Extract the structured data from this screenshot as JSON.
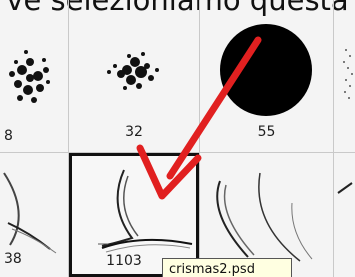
{
  "caption_text": "ve selezioniamo questa",
  "brushes": [
    {
      "id": "b1",
      "size": "8"
    },
    {
      "id": "b2",
      "size": "32"
    },
    {
      "id": "b3",
      "size": "55"
    },
    {
      "id": "b5",
      "size": "38"
    },
    {
      "id": "b6",
      "size": "1103",
      "selected": true
    },
    {
      "id": "b7",
      "size": ""
    }
  ],
  "tooltip": {
    "text": "crismas2.psd"
  },
  "colors": {
    "arrow": "#e12020",
    "selection_border": "#111111",
    "tooltip_bg": "#ffffe1"
  }
}
